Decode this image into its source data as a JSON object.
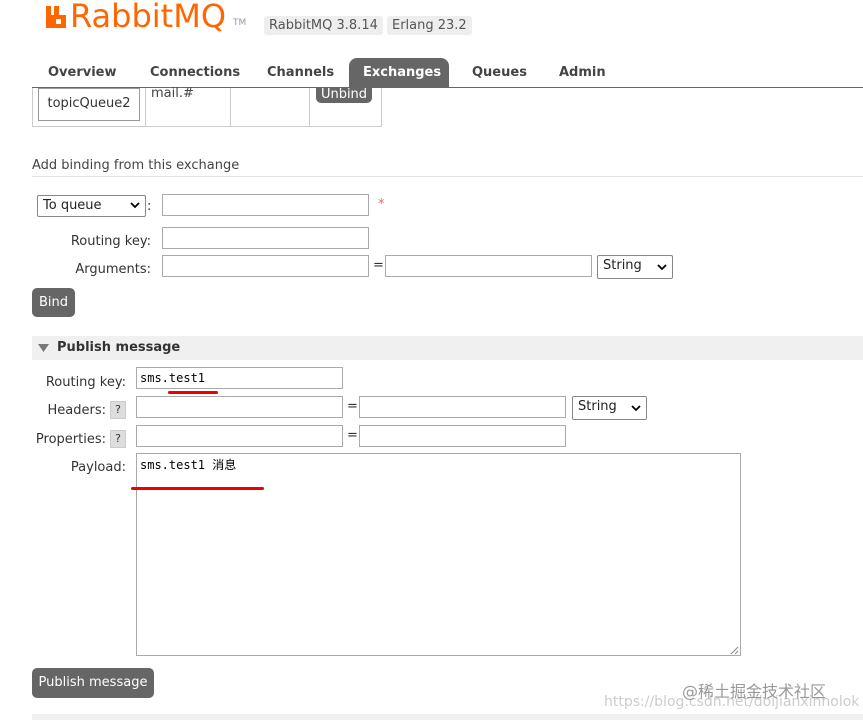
{
  "header": {
    "brand": "RabbitMQ",
    "tm": "TM",
    "version": "RabbitMQ 3.8.14",
    "erlang": "Erlang 23.2"
  },
  "tabs": [
    {
      "label": "Overview",
      "active": false
    },
    {
      "label": "Connections",
      "active": false
    },
    {
      "label": "Channels",
      "active": false
    },
    {
      "label": "Exchanges",
      "active": true
    },
    {
      "label": "Queues",
      "active": false
    },
    {
      "label": "Admin",
      "active": false
    }
  ],
  "bindings_row": {
    "queue": "topicQueue2",
    "routing_key": "mail.#",
    "unbind_label": "Unbind"
  },
  "add_binding": {
    "title": "Add binding from this exchange",
    "dest_type": "To queue",
    "colon": ":",
    "required_mark": "*",
    "routing_key_label": "Routing key:",
    "arguments_label": "Arguments:",
    "equals": "=",
    "arg_type": "String",
    "bind_label": "Bind"
  },
  "publish": {
    "title": "Publish message",
    "routing_key_label": "Routing key:",
    "routing_key_value": "sms.test1",
    "headers_label": "Headers:",
    "properties_label": "Properties:",
    "help": "?",
    "equals": "=",
    "header_type": "String",
    "payload_label": "Payload:",
    "payload_value": "sms.test1 消息",
    "button_label": "Publish message"
  },
  "watermark": {
    "url": "https://blog.csdn.net/doijianxinholok",
    "site": "@稀土掘金技术社区"
  },
  "colors": {
    "brand": "#ff6600",
    "active_tab": "#666666",
    "annotation": "#e00000"
  }
}
